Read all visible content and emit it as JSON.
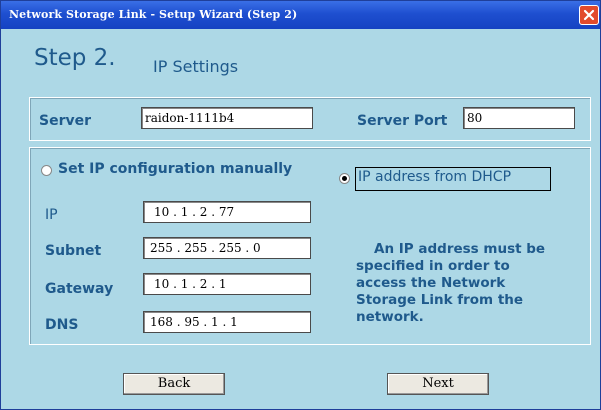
{
  "window": {
    "title": "Network Storage Link - Setup Wizard (Step 2)"
  },
  "heading": {
    "step": "Step 2.",
    "subtitle": "IP Settings"
  },
  "server": {
    "server_label": "Server",
    "server_value": "raidon-1111b4",
    "port_label": "Server Port",
    "port_value": "80"
  },
  "ip_config": {
    "manual_label": "Set IP configuration manually",
    "manual_selected": false,
    "dhcp_label": "IP address from DHCP",
    "dhcp_selected": true,
    "fields": {
      "ip_label": "IP",
      "ip_value": "10 . 1 . 2 . 77",
      "subnet_label": "Subnet",
      "subnet_value": "255 . 255 . 255 . 0",
      "gateway_label": "Gateway",
      "gateway_value": "10 . 1 . 2 . 1",
      "dns_label": "DNS",
      "dns_value": "168 . 95 . 1 . 1"
    },
    "note": "An IP address must be specified in order to access the Network Storage Link from the network."
  },
  "buttons": {
    "back": "Back",
    "next": "Next"
  },
  "colors": {
    "title_bar": "#1e4fd0",
    "background": "#add8e6",
    "label_text": "#1f5a8c",
    "close": "#e24a2c"
  }
}
